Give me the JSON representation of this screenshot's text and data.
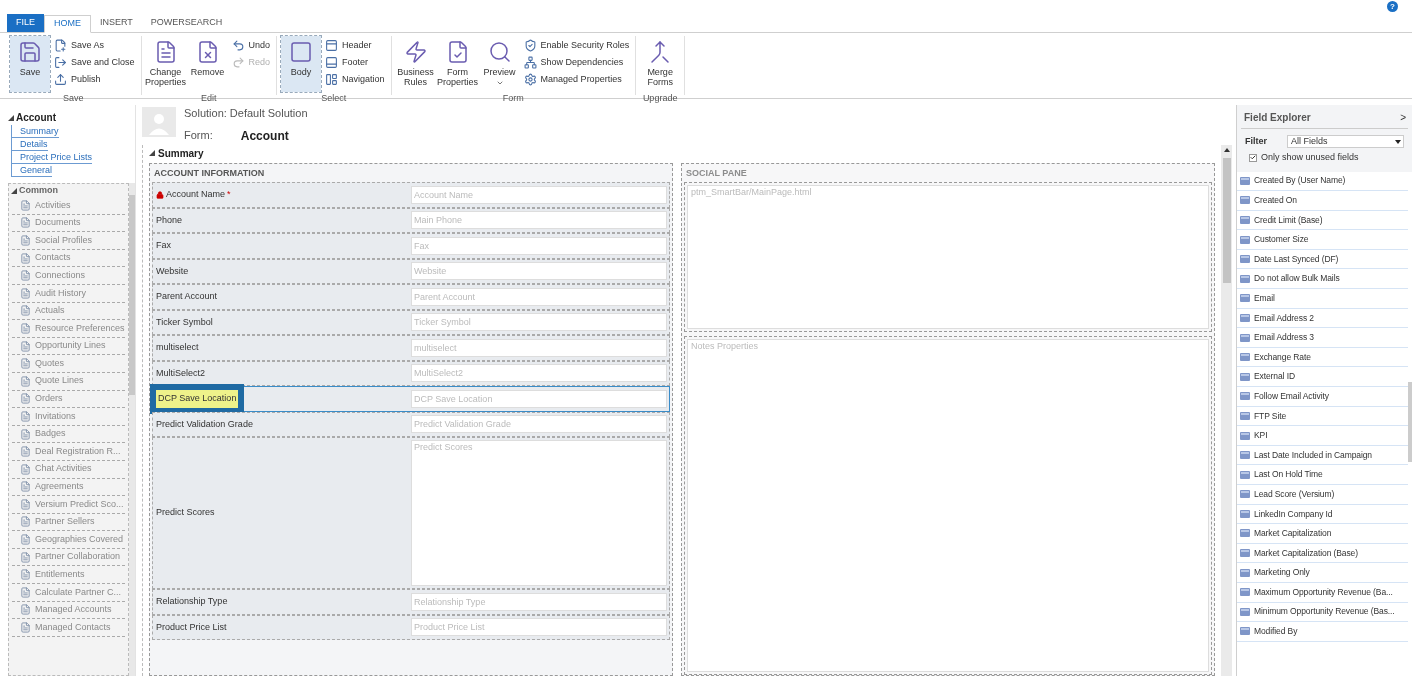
{
  "ribbon_tabs": [
    {
      "label": "FILE",
      "kind": "file",
      "selected": false
    },
    {
      "label": "HOME",
      "kind": "tab",
      "selected": true
    },
    {
      "label": "INSERT",
      "kind": "tab",
      "selected": false
    },
    {
      "label": "POWERSEARCH",
      "kind": "tab",
      "selected": false
    }
  ],
  "ribbon_groups": [
    {
      "label": "Save",
      "items": [
        {
          "label": "Save",
          "kind": "large",
          "selected": true,
          "disabled": false
        },
        {
          "label": "Save As",
          "kind": "small",
          "selected": false,
          "disabled": false
        },
        {
          "label": "Save and Close",
          "kind": "small",
          "selected": false,
          "disabled": false
        },
        {
          "label": "Publish",
          "kind": "small",
          "selected": false,
          "disabled": false
        }
      ]
    },
    {
      "label": "Edit",
      "items": [
        {
          "label": "Change Properties",
          "kind": "large",
          "selected": false,
          "disabled": false
        },
        {
          "label": "Remove",
          "kind": "large",
          "selected": false,
          "disabled": false
        },
        {
          "label": "Undo",
          "kind": "small",
          "selected": false,
          "disabled": false
        },
        {
          "label": "Redo",
          "kind": "small",
          "selected": false,
          "disabled": true
        }
      ]
    },
    {
      "label": "Select",
      "items": [
        {
          "label": "Body",
          "kind": "large",
          "selected": true,
          "disabled": false
        },
        {
          "label": "Header",
          "kind": "small",
          "selected": false,
          "disabled": false
        },
        {
          "label": "Footer",
          "kind": "small",
          "selected": false,
          "disabled": false
        },
        {
          "label": "Navigation",
          "kind": "small",
          "selected": false,
          "disabled": false
        }
      ]
    },
    {
      "label": "Form",
      "items": [
        {
          "label": "Business Rules",
          "kind": "large",
          "selected": false,
          "disabled": false
        },
        {
          "label": "Form Properties",
          "kind": "large",
          "selected": false,
          "disabled": false
        },
        {
          "label": "Preview",
          "kind": "dropdown",
          "selected": false,
          "disabled": false
        },
        {
          "label": "Enable Security Roles",
          "kind": "small",
          "selected": false,
          "disabled": false
        },
        {
          "label": "Show Dependencies",
          "kind": "small",
          "selected": false,
          "disabled": false
        },
        {
          "label": "Managed Properties",
          "kind": "small",
          "selected": false,
          "disabled": false
        }
      ]
    },
    {
      "label": "Upgrade",
      "items": [
        {
          "label": "Merge Forms",
          "kind": "large",
          "selected": false,
          "disabled": false
        }
      ]
    }
  ],
  "help": "?",
  "nav": {
    "title": "Account",
    "expanded": true,
    "links": [
      "Summary",
      "Details",
      "Project Price Lists",
      "General"
    ],
    "section": {
      "title": "Common",
      "expanded": true,
      "items": [
        "Activities",
        "Documents",
        "Social Profiles",
        "Contacts",
        "Connections",
        "Audit History",
        "Actuals",
        "Resource Preferences",
        "Opportunity Lines",
        "Quotes",
        "Quote Lines",
        "Orders",
        "Invitations",
        "Badges",
        "Deal Registration R...",
        "Chat Activities",
        "Agreements",
        "Versium Predict Sco...",
        "Partner Sellers",
        "Geographies Covered",
        "Partner Collaboration",
        "Entitlements",
        "Calculate Partner C...",
        "Managed Accounts",
        "Managed Contacts"
      ]
    }
  },
  "header": {
    "solution": "Solution: Default Solution",
    "form_label": "Form:",
    "form_name": "Account"
  },
  "tab": {
    "title": "Summary",
    "expanded": true
  },
  "account_section": {
    "title": "ACCOUNT INFORMATION",
    "fields": [
      {
        "label": "Account Name",
        "placeholder": "Account Name",
        "kind": "text",
        "locked": true,
        "required_mark": "*",
        "highlighted": false
      },
      {
        "label": "Phone",
        "placeholder": "Main Phone",
        "kind": "text",
        "locked": false,
        "highlighted": false
      },
      {
        "label": "Fax",
        "placeholder": "Fax",
        "kind": "text",
        "locked": false,
        "highlighted": false
      },
      {
        "label": "Website",
        "placeholder": "Website",
        "kind": "text",
        "locked": false,
        "highlighted": false
      },
      {
        "label": "Parent Account",
        "placeholder": "Parent Account",
        "kind": "text",
        "locked": false,
        "highlighted": false
      },
      {
        "label": "Ticker Symbol",
        "placeholder": "Ticker Symbol",
        "kind": "text",
        "locked": false,
        "highlighted": false
      },
      {
        "label": "multiselect",
        "placeholder": "multiselect",
        "kind": "text",
        "locked": false,
        "highlighted": false
      },
      {
        "label": "MultiSelect2",
        "placeholder": "MultiSelect2",
        "kind": "text",
        "locked": false,
        "highlighted": false
      },
      {
        "label": "DCP Save Location",
        "placeholder": "DCP Save Location",
        "kind": "text",
        "locked": false,
        "highlighted": true
      },
      {
        "label": "Predict Validation Grade",
        "placeholder": "Predict Validation Grade",
        "kind": "text",
        "locked": false,
        "highlighted": false
      },
      {
        "label": "Predict Scores",
        "placeholder": "Predict Scores",
        "kind": "multiline",
        "locked": false,
        "highlighted": false
      },
      {
        "label": "Relationship Type",
        "placeholder": "Relationship Type",
        "kind": "text",
        "locked": false,
        "highlighted": false
      },
      {
        "label": "Product Price List",
        "placeholder": "Product Price List",
        "kind": "text",
        "locked": false,
        "highlighted": false
      }
    ]
  },
  "social_section": {
    "title": "SOCIAL PANE",
    "web_resource": "ptm_SmartBar/MainPage.html",
    "notes": "Notes Properties"
  },
  "field_explorer": {
    "title": "Field Explorer",
    "collapse": ">",
    "filter_label": "Filter",
    "filter_value": "All Fields",
    "unused_only": {
      "label": "Only show unused fields",
      "checked": true
    },
    "fields": [
      "Created By (User Name)",
      "Created On",
      "Credit Limit (Base)",
      "Customer Size",
      "Date Last Synced (DF)",
      "Do not allow Bulk Mails",
      "Email",
      "Email Address 2",
      "Email Address 3",
      "Exchange Rate",
      "External ID",
      "Follow Email Activity",
      "FTP Site",
      "KPI",
      "Last Date Included in Campaign",
      "Last On Hold Time",
      "Lead Score (Versium)",
      "LinkedIn Company Id",
      "Market Capitalization",
      "Market Capitalization (Base)",
      "Marketing Only",
      "Maximum Opportunity Revenue (Ba...",
      "Minimum Opportunity Revenue (Bas...",
      "Modified By"
    ]
  }
}
